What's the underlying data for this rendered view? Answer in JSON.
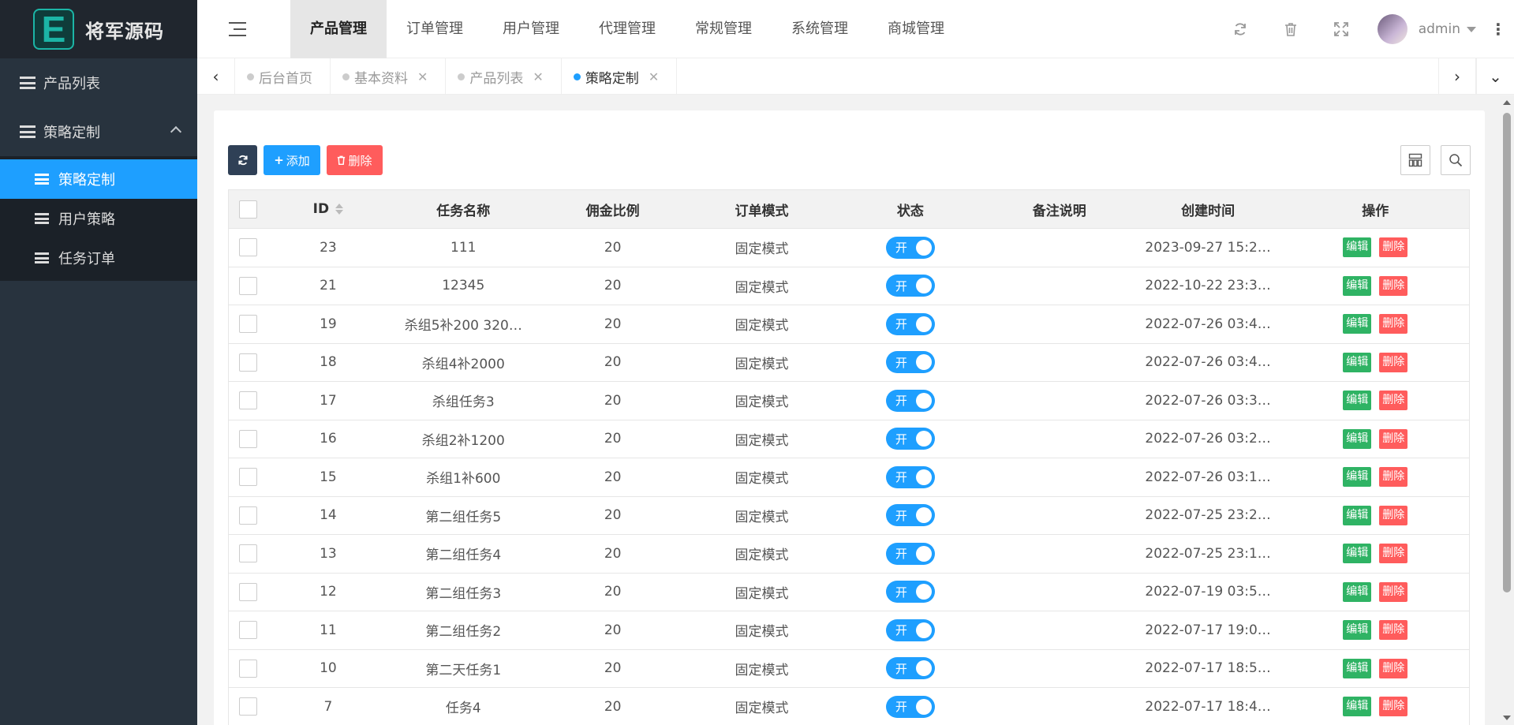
{
  "logo": {
    "mark": "E",
    "text": "将军源码"
  },
  "sidebar": {
    "items": [
      {
        "label": "产品列表"
      },
      {
        "label": "策略定制"
      }
    ],
    "submenu": [
      {
        "label": "策略定制",
        "active": true
      },
      {
        "label": "用户策略"
      },
      {
        "label": "任务订单"
      }
    ]
  },
  "topnav": [
    "产品管理",
    "订单管理",
    "用户管理",
    "代理管理",
    "常规管理",
    "系统管理",
    "商城管理"
  ],
  "header": {
    "username": "admin"
  },
  "tabs": [
    {
      "label": "后台首页",
      "closable": false
    },
    {
      "label": "基本资料",
      "closable": true
    },
    {
      "label": "产品列表",
      "closable": true
    },
    {
      "label": "策略定制",
      "closable": true,
      "active": true
    }
  ],
  "toolbar": {
    "add_label": "添加",
    "delete_label": "删除"
  },
  "table": {
    "columns": [
      "ID",
      "任务名称",
      "佣金比例",
      "订单模式",
      "状态",
      "备注说明",
      "创建时间",
      "操作"
    ],
    "switch_label": "开",
    "edit_label": "编辑",
    "delete_label": "删除",
    "rows": [
      {
        "id": "23",
        "name": "111",
        "rate": "20",
        "mode": "固定模式",
        "note": "",
        "created": "2023-09-27 15:2…"
      },
      {
        "id": "21",
        "name": "12345",
        "rate": "20",
        "mode": "固定模式",
        "note": "",
        "created": "2022-10-22 23:3…"
      },
      {
        "id": "19",
        "name": "杀组5补200 320…",
        "rate": "20",
        "mode": "固定模式",
        "note": "",
        "created": "2022-07-26 03:4…"
      },
      {
        "id": "18",
        "name": "杀组4补2000",
        "rate": "20",
        "mode": "固定模式",
        "note": "",
        "created": "2022-07-26 03:4…"
      },
      {
        "id": "17",
        "name": "杀组任务3",
        "rate": "20",
        "mode": "固定模式",
        "note": "",
        "created": "2022-07-26 03:3…"
      },
      {
        "id": "16",
        "name": "杀组2补1200",
        "rate": "20",
        "mode": "固定模式",
        "note": "",
        "created": "2022-07-26 03:2…"
      },
      {
        "id": "15",
        "name": "杀组1补600",
        "rate": "20",
        "mode": "固定模式",
        "note": "",
        "created": "2022-07-26 03:1…"
      },
      {
        "id": "14",
        "name": "第二组任务5",
        "rate": "20",
        "mode": "固定模式",
        "note": "",
        "created": "2022-07-25 23:2…"
      },
      {
        "id": "13",
        "name": "第二组任务4",
        "rate": "20",
        "mode": "固定模式",
        "note": "",
        "created": "2022-07-25 23:1…"
      },
      {
        "id": "12",
        "name": "第二组任务3",
        "rate": "20",
        "mode": "固定模式",
        "note": "",
        "created": "2022-07-19 03:5…"
      },
      {
        "id": "11",
        "name": "第二组任务2",
        "rate": "20",
        "mode": "固定模式",
        "note": "",
        "created": "2022-07-17 19:0…"
      },
      {
        "id": "10",
        "name": "第二天任务1",
        "rate": "20",
        "mode": "固定模式",
        "note": "",
        "created": "2022-07-17 18:5…"
      },
      {
        "id": "7",
        "name": "任务4",
        "rate": "20",
        "mode": "固定模式",
        "note": "",
        "created": "2022-07-17 18:4…"
      }
    ]
  },
  "colors": {
    "accent": "#1e9fff",
    "sidebar": "#28333e",
    "danger": "#ff5c5c",
    "success": "#2fb364"
  }
}
